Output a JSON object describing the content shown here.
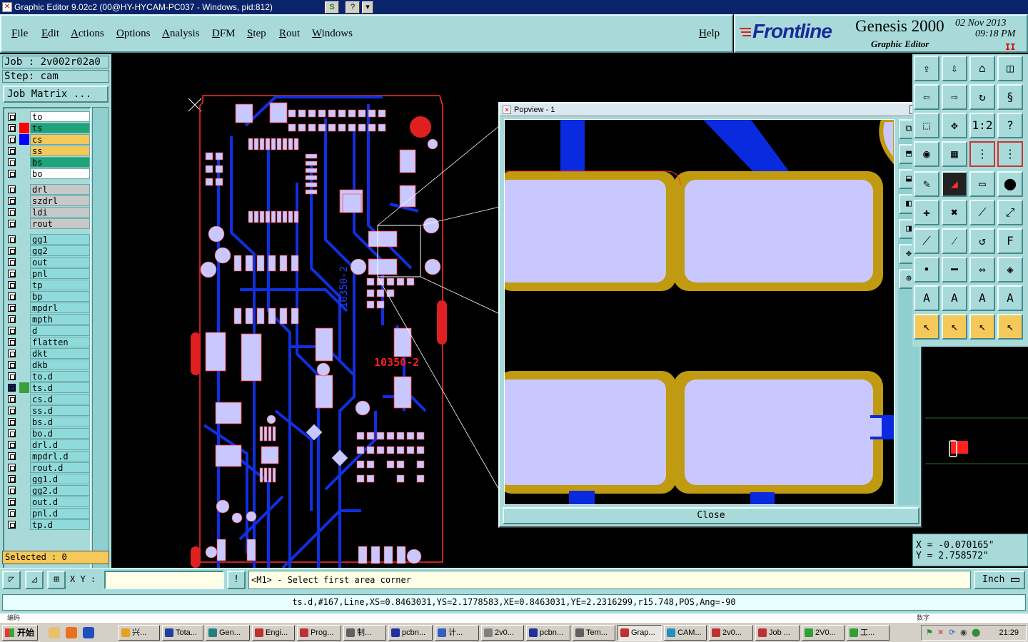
{
  "window": {
    "title": "Graphic Editor 9.02c2 (00@HY-HYCAM-PC037 - Windows, pid:812)"
  },
  "menu": [
    "File",
    "Edit",
    "Actions",
    "Options",
    "Analysis",
    "DFM",
    "Step",
    "Rout",
    "Windows"
  ],
  "help_label": "Help",
  "brand": {
    "name": "Frontline",
    "product": "Genesis 2000",
    "subtitle": "Graphic Editor",
    "date": "02  Nov  2013",
    "time": "09:18  PM",
    "pause": "II"
  },
  "job": {
    "job_line": "Job : 2v002r02a0",
    "step_line": "Step: cam",
    "matrix_button": "Job Matrix ..."
  },
  "layers": [
    {
      "name": "to",
      "color": "#ffffff",
      "swatch": ""
    },
    {
      "name": "ts",
      "color": "#1fa37a",
      "swatch": "#ff0000"
    },
    {
      "name": "cs",
      "color": "#f5c85a",
      "swatch": "#0000ff"
    },
    {
      "name": "ss",
      "color": "#f5c85a",
      "swatch": ""
    },
    {
      "name": "bs",
      "color": "#1fa37a",
      "swatch": ""
    },
    {
      "name": "bo",
      "color": "#ffffff",
      "swatch": ""
    },
    {
      "name": "drl",
      "color": "#c8c8c8",
      "swatch": ""
    },
    {
      "name": "szdrl",
      "color": "#c8c8c8",
      "swatch": ""
    },
    {
      "name": "ldi",
      "color": "#c8c8c8",
      "swatch": ""
    },
    {
      "name": "rout",
      "color": "#c8c8c8",
      "swatch": ""
    },
    {
      "name": "gg1",
      "color": "#8fdada",
      "swatch": ""
    },
    {
      "name": "gg2",
      "color": "#8fdada",
      "swatch": ""
    },
    {
      "name": "out",
      "color": "#8fdada",
      "swatch": ""
    },
    {
      "name": "pnl",
      "color": "#8fdada",
      "swatch": "",
      "flag": "✎"
    },
    {
      "name": "tp",
      "color": "#8fdada",
      "swatch": ""
    },
    {
      "name": "bp",
      "color": "#8fdada",
      "swatch": ""
    },
    {
      "name": "mpdrl",
      "color": "#8fdada",
      "swatch": ""
    },
    {
      "name": "mpth",
      "color": "#8fdada",
      "swatch": ""
    },
    {
      "name": "d",
      "color": "#8fdada",
      "swatch": ""
    },
    {
      "name": "flatten",
      "color": "#8fdada",
      "swatch": ""
    },
    {
      "name": "dkt",
      "color": "#8fdada",
      "swatch": ""
    },
    {
      "name": "dkb",
      "color": "#8fdada",
      "swatch": ""
    },
    {
      "name": "to.d",
      "color": "#8fdada",
      "swatch": ""
    },
    {
      "name": "ts.d",
      "color": "#8fdada",
      "swatch": "#3aa03a",
      "flag": "▣",
      "active": true
    },
    {
      "name": "cs.d",
      "color": "#8fdada",
      "swatch": ""
    },
    {
      "name": "ss.d",
      "color": "#8fdada",
      "swatch": ""
    },
    {
      "name": "bs.d",
      "color": "#8fdada",
      "swatch": ""
    },
    {
      "name": "bo.d",
      "color": "#8fdada",
      "swatch": ""
    },
    {
      "name": "drl.d",
      "color": "#8fdada",
      "swatch": ""
    },
    {
      "name": "mpdrl.d",
      "color": "#8fdada",
      "swatch": ""
    },
    {
      "name": "rout.d",
      "color": "#8fdada",
      "swatch": ""
    },
    {
      "name": "gg1.d",
      "color": "#8fdada",
      "swatch": ""
    },
    {
      "name": "gg2.d",
      "color": "#8fdada",
      "swatch": ""
    },
    {
      "name": "out.d",
      "color": "#8fdada",
      "swatch": ""
    },
    {
      "name": "pnl.d",
      "color": "#8fdada",
      "swatch": "",
      "flag": "✎"
    },
    {
      "name": "tp.d",
      "color": "#8fdada",
      "swatch": ""
    }
  ],
  "selected_text": "Selected : 0",
  "board": {
    "label_vertical": "10350-2",
    "label_red": "10350-2"
  },
  "popview": {
    "title": "Popview - 1",
    "close_label": "Close"
  },
  "coords": {
    "x": "X = -0.070165\"",
    "y": "Y =  2.758572\""
  },
  "cmd": {
    "xy_label": "X Y :",
    "prompt": "<M1> - Select first area corner",
    "units": "Inch"
  },
  "status": "ts.d,#167,Line,XS=0.8463031,YS=2.1778583,XE=0.8463031,YE=2.2316299,r15.748,POS,Ang=-90",
  "taskbar": {
    "start": "开始",
    "top_left": "编码",
    "top_right": "数字",
    "clock": "21:29",
    "tasks": [
      {
        "label": "兴...",
        "color": "#e8a020"
      },
      {
        "label": "Tota...",
        "color": "#2040a0"
      },
      {
        "label": "Gen...",
        "color": "#208080"
      },
      {
        "label": "Engi...",
        "color": "#c03030"
      },
      {
        "label": "Prog...",
        "color": "#c03030"
      },
      {
        "label": "制...",
        "color": "#606060"
      },
      {
        "label": "pcbn...",
        "color": "#2030a0"
      },
      {
        "label": "计...",
        "color": "#3060c0"
      },
      {
        "label": "2v0...",
        "color": "#808080"
      },
      {
        "label": "pcbn...",
        "color": "#2030a0"
      },
      {
        "label": "Tem...",
        "color": "#606060"
      },
      {
        "label": "Grap...",
        "color": "#c03030"
      },
      {
        "label": "CAM...",
        "color": "#2090c0"
      },
      {
        "label": "2v0...",
        "color": "#c03030"
      },
      {
        "label": "Job ...",
        "color": "#c03030"
      },
      {
        "label": "2V0...",
        "color": "#30a030"
      },
      {
        "label": "工...",
        "color": "#30a030"
      }
    ]
  }
}
